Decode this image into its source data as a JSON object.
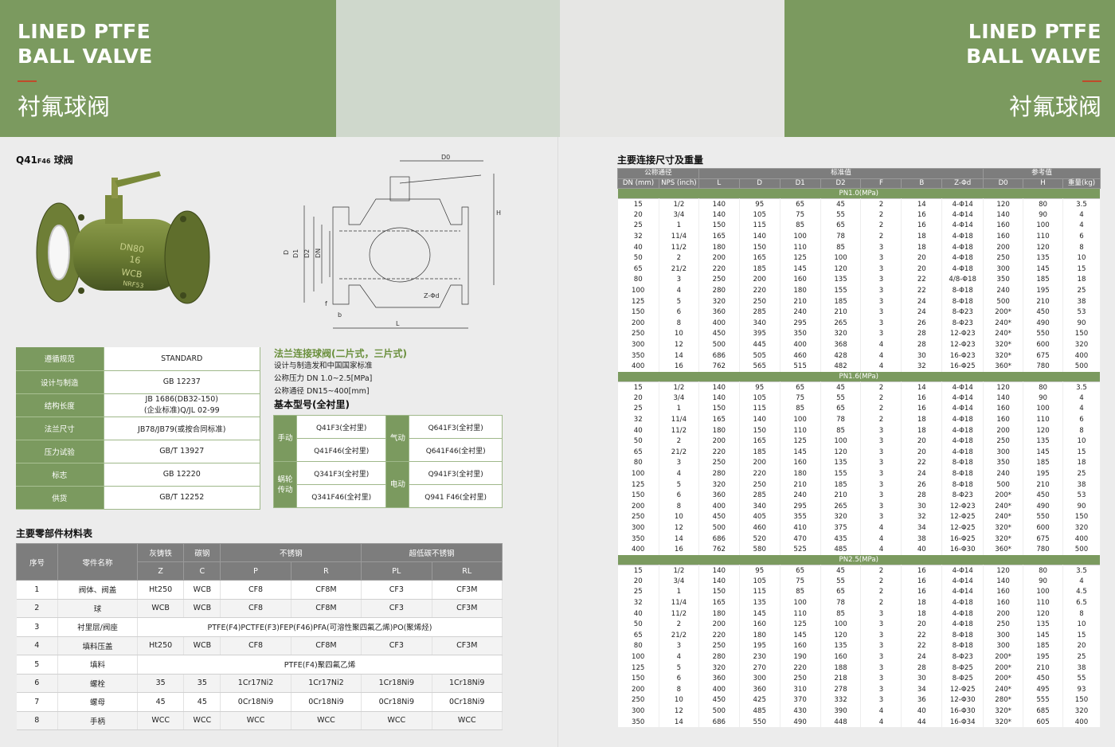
{
  "header": {
    "title_en_line1": "LINED PTFE",
    "title_en_line2": "BALL VALVE",
    "title_cn": "衬氟球阀"
  },
  "product": {
    "title_prefix": "Q41",
    "title_sub": "F46",
    "title_suffix": "球阀"
  },
  "drawing_labels": [
    "D0",
    "H",
    "D",
    "D1",
    "D2",
    "DN",
    "Z-Φd",
    "f",
    "b",
    "L"
  ],
  "valve_marking": [
    "DN80",
    "16",
    "WCB",
    "NRF53"
  ],
  "spec_table": [
    {
      "k": "遵循规范",
      "v": "STANDARD"
    },
    {
      "k": "设计与制造",
      "v": "GB 12237"
    },
    {
      "k": "结构长度",
      "v": "JB 1686(DB32-150)",
      "v2": "(企业标准)Q/JL 02-99"
    },
    {
      "k": "法兰尺寸",
      "v": "JB78/JB79(或按合同标准)"
    },
    {
      "k": "压力试验",
      "v": "GB/T 13927"
    },
    {
      "k": "标志",
      "v": "GB 12220"
    },
    {
      "k": "供货",
      "v": "GB/T 12252"
    }
  ],
  "description": {
    "heading": "法兰连接球阀(二片式，三片式)",
    "lines": [
      "设计与制造发和中国国家标准",
      "公称压力 DN 1.0~2.5[MPa]",
      "公称通径 DN15~400[mm]"
    ],
    "model_heading": "基本型号(全衬里)"
  },
  "models": {
    "manual": "手动",
    "pneumatic": "气动",
    "worm_1": "蜗轮",
    "worm_2": "传动",
    "electric": "电动",
    "q41f3": "Q41F3(全衬里)",
    "q641f3": "Q641F3(全衬里)",
    "q41f46": "Q41F46(全衬里)",
    "q641f46": "Q641F46(全衬里)",
    "q341f3": "Q341F3(全衬里)",
    "q941f3": "Q941F3(全衬里)",
    "q341f46": "Q341F46(全衬里)",
    "q941f46": "Q941 F46(全衬里)"
  },
  "materials": {
    "title": "主要零部件材料表",
    "h_no": "序号",
    "h_name": "零件名称",
    "h_grey": "灰铸铁",
    "h_carbon": "碳钢",
    "h_ss": "不锈钢",
    "h_ulc": "超低碳不锈钢",
    "sub": [
      "Z",
      "C",
      "P",
      "R",
      "PL",
      "RL"
    ],
    "row1": [
      "1",
      "阀体、阀盖",
      "Ht250",
      "WCB",
      "CF8",
      "CF8M",
      "CF3",
      "CF3M"
    ],
    "row2": [
      "2",
      "球",
      "WCB",
      "WCB",
      "CF8",
      "CF8M",
      "CF3",
      "CF3M"
    ],
    "row3_no": "3",
    "row3_name": "衬里层/阀座",
    "row3_all": "PTFE(F4)PCTFE(F3)FEP(F46)PFA(可溶性聚四氟乙烯)PO(聚烯烃)",
    "row4": [
      "4",
      "填料压盖",
      "Ht250",
      "WCB",
      "CF8",
      "CF8M",
      "CF3",
      "CF3M"
    ],
    "row5_no": "5",
    "row5_name": "填料",
    "row5_all": "PTFE(F4)聚四氟乙烯",
    "row6": [
      "6",
      "螺栓",
      "35",
      "35",
      "1Cr17Ni2",
      "1Cr17Ni2",
      "1Cr18Ni9",
      "1Cr18Ni9"
    ],
    "row7": [
      "7",
      "螺母",
      "45",
      "45",
      "0Cr18Ni9",
      "0Cr18Ni9",
      "0Cr18Ni9",
      "0Cr18Ni9"
    ],
    "row8": [
      "8",
      "手柄",
      "WCC",
      "WCC",
      "WCC",
      "WCC",
      "WCC",
      "WCC"
    ]
  },
  "dimensions": {
    "title": "主要连接尺寸及重量",
    "h_nominal": "公称通径",
    "h_standard": "标准值",
    "h_ref": "参考值",
    "cols": [
      "DN (mm)",
      "NPS (inch)",
      "L",
      "D",
      "D1",
      "D2",
      "F",
      "B",
      "Z-Φd",
      "D0",
      "H",
      "重量(kg)"
    ],
    "groups": [
      {
        "label": "PN1.0(MPa)",
        "rows": [
          [
            "15",
            "1/2",
            "140",
            "95",
            "65",
            "45",
            "2",
            "14",
            "4-Φ14",
            "120",
            "80",
            "3.5"
          ],
          [
            "20",
            "3/4",
            "140",
            "105",
            "75",
            "55",
            "2",
            "16",
            "4-Φ14",
            "140",
            "90",
            "4"
          ],
          [
            "25",
            "1",
            "150",
            "115",
            "85",
            "65",
            "2",
            "16",
            "4-Φ14",
            "160",
            "100",
            "4"
          ],
          [
            "32",
            "11/4",
            "165",
            "140",
            "100",
            "78",
            "2",
            "18",
            "4-Φ18",
            "160",
            "110",
            "6"
          ],
          [
            "40",
            "11/2",
            "180",
            "150",
            "110",
            "85",
            "3",
            "18",
            "4-Φ18",
            "200",
            "120",
            "8"
          ],
          [
            "50",
            "2",
            "200",
            "165",
            "125",
            "100",
            "3",
            "20",
            "4-Φ18",
            "250",
            "135",
            "10"
          ],
          [
            "65",
            "21/2",
            "220",
            "185",
            "145",
            "120",
            "3",
            "20",
            "4-Φ18",
            "300",
            "145",
            "15"
          ],
          [
            "80",
            "3",
            "250",
            "200",
            "160",
            "135",
            "3",
            "22",
            "4/8-Φ18",
            "350",
            "185",
            "18"
          ],
          [
            "100",
            "4",
            "280",
            "220",
            "180",
            "155",
            "3",
            "22",
            "8-Φ18",
            "240",
            "195",
            "25"
          ],
          [
            "125",
            "5",
            "320",
            "250",
            "210",
            "185",
            "3",
            "24",
            "8-Φ18",
            "500",
            "210",
            "38"
          ],
          [
            "150",
            "6",
            "360",
            "285",
            "240",
            "210",
            "3",
            "24",
            "8-Φ23",
            "200*",
            "450",
            "53"
          ],
          [
            "200",
            "8",
            "400",
            "340",
            "295",
            "265",
            "3",
            "26",
            "8-Φ23",
            "240*",
            "490",
            "90"
          ],
          [
            "250",
            "10",
            "450",
            "395",
            "350",
            "320",
            "3",
            "28",
            "12-Φ23",
            "240*",
            "550",
            "150"
          ],
          [
            "300",
            "12",
            "500",
            "445",
            "400",
            "368",
            "4",
            "28",
            "12-Φ23",
            "320*",
            "600",
            "320"
          ],
          [
            "350",
            "14",
            "686",
            "505",
            "460",
            "428",
            "4",
            "30",
            "16-Φ23",
            "320*",
            "675",
            "400"
          ],
          [
            "400",
            "16",
            "762",
            "565",
            "515",
            "482",
            "4",
            "32",
            "16-Φ25",
            "360*",
            "780",
            "500"
          ]
        ]
      },
      {
        "label": "PN1.6(MPa)",
        "rows": [
          [
            "15",
            "1/2",
            "140",
            "95",
            "65",
            "45",
            "2",
            "14",
            "4-Φ14",
            "120",
            "80",
            "3.5"
          ],
          [
            "20",
            "3/4",
            "140",
            "105",
            "75",
            "55",
            "2",
            "16",
            "4-Φ14",
            "140",
            "90",
            "4"
          ],
          [
            "25",
            "1",
            "150",
            "115",
            "85",
            "65",
            "2",
            "16",
            "4-Φ14",
            "160",
            "100",
            "4"
          ],
          [
            "32",
            "11/4",
            "165",
            "140",
            "100",
            "78",
            "2",
            "18",
            "4-Φ18",
            "160",
            "110",
            "6"
          ],
          [
            "40",
            "11/2",
            "180",
            "150",
            "110",
            "85",
            "3",
            "18",
            "4-Φ18",
            "200",
            "120",
            "8"
          ],
          [
            "50",
            "2",
            "200",
            "165",
            "125",
            "100",
            "3",
            "20",
            "4-Φ18",
            "250",
            "135",
            "10"
          ],
          [
            "65",
            "21/2",
            "220",
            "185",
            "145",
            "120",
            "3",
            "20",
            "4-Φ18",
            "300",
            "145",
            "15"
          ],
          [
            "80",
            "3",
            "250",
            "200",
            "160",
            "135",
            "3",
            "22",
            "8-Φ18",
            "350",
            "185",
            "18"
          ],
          [
            "100",
            "4",
            "280",
            "220",
            "180",
            "155",
            "3",
            "24",
            "8-Φ18",
            "240",
            "195",
            "25"
          ],
          [
            "125",
            "5",
            "320",
            "250",
            "210",
            "185",
            "3",
            "26",
            "8-Φ18",
            "500",
            "210",
            "38"
          ],
          [
            "150",
            "6",
            "360",
            "285",
            "240",
            "210",
            "3",
            "28",
            "8-Φ23",
            "200*",
            "450",
            "53"
          ],
          [
            "200",
            "8",
            "400",
            "340",
            "295",
            "265",
            "3",
            "30",
            "12-Φ23",
            "240*",
            "490",
            "90"
          ],
          [
            "250",
            "10",
            "450",
            "405",
            "355",
            "320",
            "3",
            "32",
            "12-Φ25",
            "240*",
            "550",
            "150"
          ],
          [
            "300",
            "12",
            "500",
            "460",
            "410",
            "375",
            "4",
            "34",
            "12-Φ25",
            "320*",
            "600",
            "320"
          ],
          [
            "350",
            "14",
            "686",
            "520",
            "470",
            "435",
            "4",
            "38",
            "16-Φ25",
            "320*",
            "675",
            "400"
          ],
          [
            "400",
            "16",
            "762",
            "580",
            "525",
            "485",
            "4",
            "40",
            "16-Φ30",
            "360*",
            "780",
            "500"
          ]
        ]
      },
      {
        "label": "PN2.5(MPa)",
        "rows": [
          [
            "15",
            "1/2",
            "140",
            "95",
            "65",
            "45",
            "2",
            "16",
            "4-Φ14",
            "120",
            "80",
            "3.5"
          ],
          [
            "20",
            "3/4",
            "140",
            "105",
            "75",
            "55",
            "2",
            "16",
            "4-Φ14",
            "140",
            "90",
            "4"
          ],
          [
            "25",
            "1",
            "150",
            "115",
            "85",
            "65",
            "2",
            "16",
            "4-Φ14",
            "160",
            "100",
            "4.5"
          ],
          [
            "32",
            "11/4",
            "165",
            "135",
            "100",
            "78",
            "2",
            "18",
            "4-Φ18",
            "160",
            "110",
            "6.5"
          ],
          [
            "40",
            "11/2",
            "180",
            "145",
            "110",
            "85",
            "3",
            "18",
            "4-Φ18",
            "200",
            "120",
            "8"
          ],
          [
            "50",
            "2",
            "200",
            "160",
            "125",
            "100",
            "3",
            "20",
            "4-Φ18",
            "250",
            "135",
            "10"
          ],
          [
            "65",
            "21/2",
            "220",
            "180",
            "145",
            "120",
            "3",
            "22",
            "8-Φ18",
            "300",
            "145",
            "15"
          ],
          [
            "80",
            "3",
            "250",
            "195",
            "160",
            "135",
            "3",
            "22",
            "8-Φ18",
            "300",
            "185",
            "20"
          ],
          [
            "100",
            "4",
            "280",
            "230",
            "190",
            "160",
            "3",
            "24",
            "8-Φ23",
            "200*",
            "195",
            "25"
          ],
          [
            "125",
            "5",
            "320",
            "270",
            "220",
            "188",
            "3",
            "28",
            "8-Φ25",
            "200*",
            "210",
            "38"
          ],
          [
            "150",
            "6",
            "360",
            "300",
            "250",
            "218",
            "3",
            "30",
            "8-Φ25",
            "200*",
            "450",
            "55"
          ],
          [
            "200",
            "8",
            "400",
            "360",
            "310",
            "278",
            "3",
            "34",
            "12-Φ25",
            "240*",
            "495",
            "93"
          ],
          [
            "250",
            "10",
            "450",
            "425",
            "370",
            "332",
            "3",
            "36",
            "12-Φ30",
            "280*",
            "555",
            "150"
          ],
          [
            "300",
            "12",
            "500",
            "485",
            "430",
            "390",
            "4",
            "40",
            "16-Φ30",
            "320*",
            "685",
            "320"
          ],
          [
            "350",
            "14",
            "686",
            "550",
            "490",
            "448",
            "4",
            "44",
            "16-Φ34",
            "320*",
            "605",
            "400"
          ]
        ]
      }
    ]
  }
}
